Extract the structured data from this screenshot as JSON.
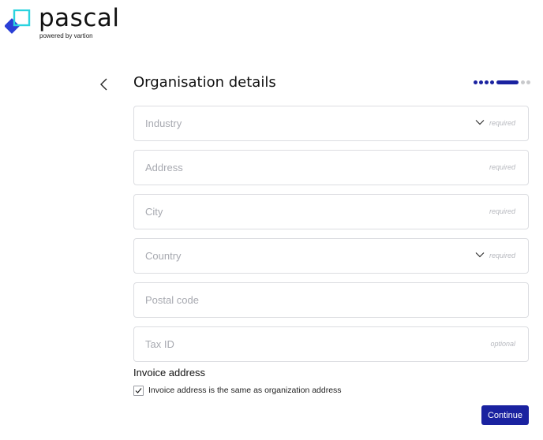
{
  "brand": {
    "name": "pascal",
    "tagline": "powered by vartion",
    "colors": {
      "primary": "#1a22a0",
      "accent": "#2ad3df",
      "logo_blue": "#2a3fd6"
    }
  },
  "header": {
    "back_icon": "chevron-left-icon",
    "title": "Organisation details",
    "progress": {
      "completed_steps": 5,
      "current_step": 5,
      "total_steps": 7
    }
  },
  "form": {
    "fields": [
      {
        "placeholder": "Industry",
        "hint": "required",
        "type": "select",
        "icon": "chevron-down-icon"
      },
      {
        "placeholder": "Address",
        "hint": "required",
        "type": "text"
      },
      {
        "placeholder": "City",
        "hint": "required",
        "type": "text"
      },
      {
        "placeholder": "Country",
        "hint": "required",
        "type": "select",
        "icon": "chevron-down-icon"
      },
      {
        "placeholder": "Postal code",
        "hint": "",
        "type": "text"
      },
      {
        "placeholder": "Tax ID",
        "hint": "optional",
        "type": "text"
      }
    ],
    "invoice": {
      "heading": "Invoice address",
      "same_as_org_label": "Invoice address is the same as organization address",
      "same_as_org_checked": true
    },
    "continue_label": "Continue"
  }
}
